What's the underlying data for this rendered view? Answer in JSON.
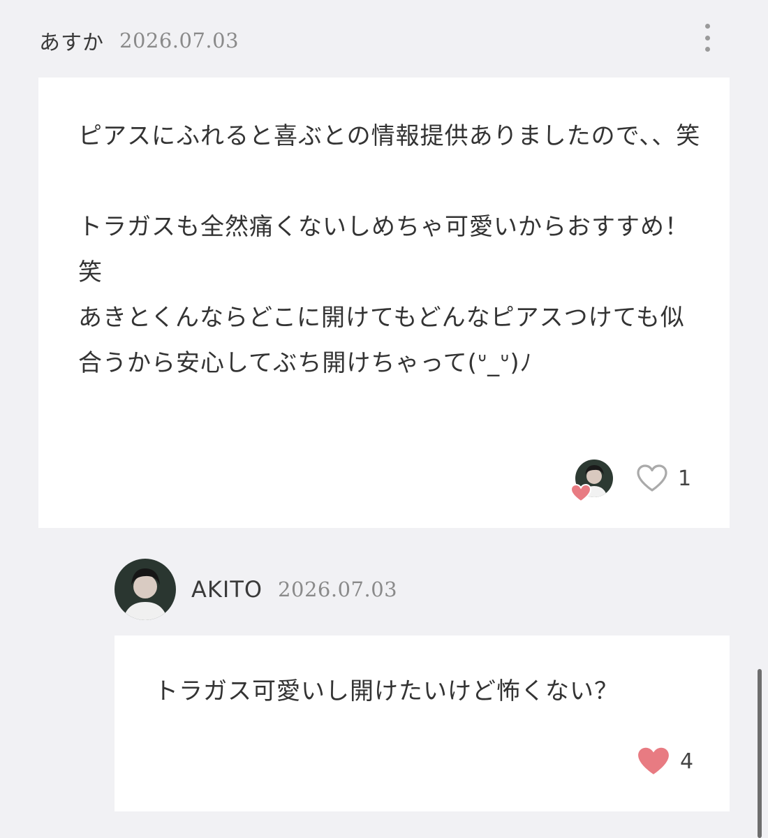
{
  "comment": {
    "author": "あすか",
    "date": "2026.07.03",
    "body": "ピアスにふれると喜ぶとの情報提供ありましたので、、笑\n\nトラガスも全然痛くないしめちゃ可愛いからおすすめ！笑\nあきとくんならどこに開けてもどんなピアスつけても似合うから安心してぶち開けちゃって(ᐡ_ᐡ)ﾉ",
    "like_count": "1",
    "liked": false,
    "more_icon": "more-vertical-icon",
    "like_icon": "heart-outline-icon"
  },
  "reply": {
    "author": "AKITO",
    "date": "2026.07.03",
    "body": "トラガス可愛いし開けたいけど怖くない？",
    "like_count": "4",
    "liked": true,
    "like_icon": "heart-filled-icon"
  },
  "colors": {
    "background": "#f1f1f4",
    "card": "#ffffff",
    "heart_active": "#e87b82",
    "heart_inactive": "#aaaaaa",
    "text": "#333333",
    "muted": "#8a8a8a"
  }
}
